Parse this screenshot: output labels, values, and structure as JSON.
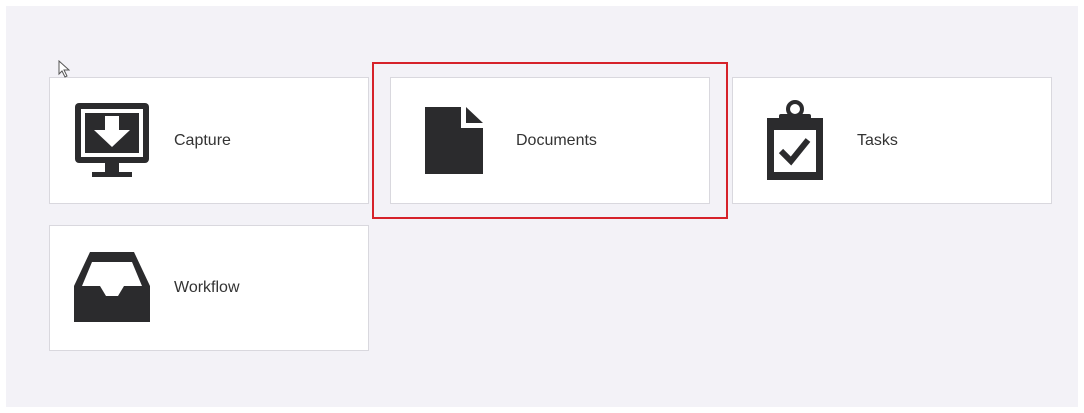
{
  "tiles": [
    {
      "label": "Capture",
      "icon": "monitor-download-icon"
    },
    {
      "label": "Documents",
      "icon": "document-icon"
    },
    {
      "label": "Tasks",
      "icon": "clipboard-check-icon"
    },
    {
      "label": "Workflow",
      "icon": "inbox-tray-icon"
    }
  ],
  "colors": {
    "background": "#f3f2f7",
    "tile": "#ffffff",
    "icon": "#2b2b2d",
    "highlight": "#d6222a"
  }
}
